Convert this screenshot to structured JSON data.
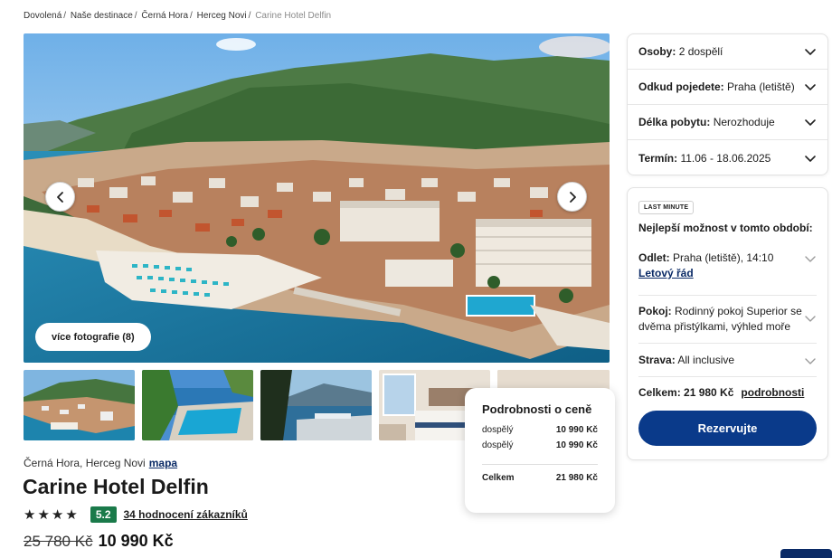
{
  "breadcrumb": {
    "items": [
      "Dovolená",
      "Naše destinace",
      "Černá Hora",
      "Herceg Novi"
    ],
    "current": "Carine Hotel Delfin",
    "separator": "/"
  },
  "gallery": {
    "more_photos_label": "více fotografie (8)",
    "prev_icon": "chevron-left-icon",
    "next_icon": "chevron-right-icon",
    "thumbnail_count": 5
  },
  "hotel": {
    "location": "Černá Hora, Herceg Novi",
    "map_label": "mapa",
    "name": "Carine Hotel Delfin",
    "stars": 4,
    "star_glyph": "★",
    "score": "5.2",
    "reviews_label": "34 hodnocení zákazníků",
    "old_price": "25 780 Kč",
    "new_price": "10 990 Kč"
  },
  "price_popup": {
    "title": "Podrobnosti o ceně",
    "rows": [
      {
        "label": "dospělý",
        "value": "10 990 Kč"
      },
      {
        "label": "dospělý",
        "value": "10 990 Kč"
      }
    ],
    "total_label": "Celkem",
    "total_value": "21 980 Kč"
  },
  "filters": [
    {
      "label": "Osoby:",
      "value": "2 dospělí"
    },
    {
      "label": "Odkud pojedete:",
      "value": "Praha (letiště)"
    },
    {
      "label": "Délka pobytu:",
      "value": "Nerozhoduje"
    },
    {
      "label": "Termín:",
      "value": "11.06 - 18.06.2025"
    }
  ],
  "offer": {
    "badge": "LAST MINUTE",
    "title": "Nejlepší možnost v tomto období:",
    "departure_label": "Odlet:",
    "departure_value": "Praha (letiště), 14:10",
    "schedule_link": "Letový řád",
    "room_label": "Pokoj:",
    "room_value": "Rodinný pokoj Superior se dvěma přistýlkami, výhled moře",
    "board_label": "Strava:",
    "board_value": "All inclusive",
    "total_label": "Celkem: 21 980 Kč",
    "details_link": "podrobnosti",
    "book_button": "Rezervujte"
  },
  "colors": {
    "brand_dark": "#0a3a8a",
    "link": "#0a2a66",
    "score_bg": "#1a7a4a",
    "sea": "#1f8fb3"
  }
}
